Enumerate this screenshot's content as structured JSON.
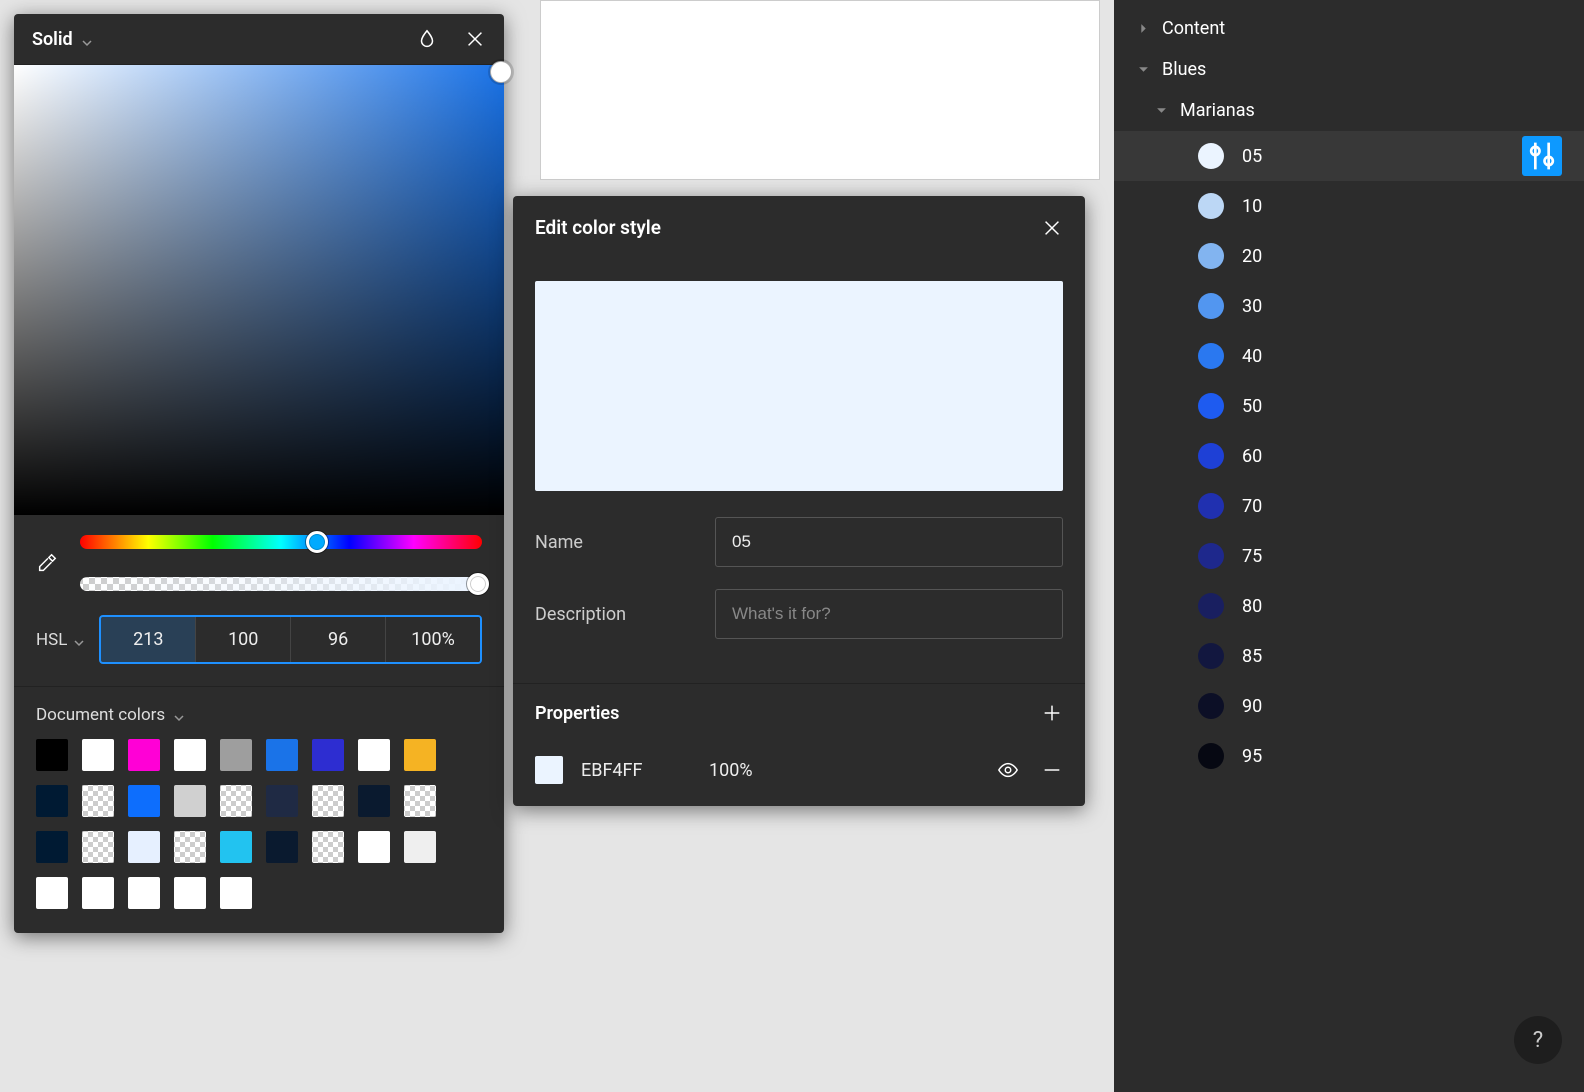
{
  "color_picker": {
    "mode_label": "Solid",
    "model_label": "HSL",
    "h": "213",
    "s": "100",
    "l": "96",
    "a": "100%",
    "doc_colors_label": "Document colors",
    "doc_swatches": [
      {
        "c": "#000000"
      },
      {
        "c": "#ffffff"
      },
      {
        "c": "#ff00d6"
      },
      {
        "c": "#ffffff"
      },
      {
        "c": "#9e9e9e"
      },
      {
        "c": "#1a73e8"
      },
      {
        "c": "#2d2dd1"
      },
      {
        "c": "#ffffff"
      },
      {
        "c": "#f5b323"
      },
      {
        "c": "#001a33"
      },
      {
        "checker": true
      },
      {
        "c": "#0d6efd"
      },
      {
        "c": "#d0d0d0"
      },
      {
        "checker": true
      },
      {
        "c": "#1f2a44"
      },
      {
        "checker": true
      },
      {
        "c": "#0a1a2f"
      },
      {
        "checker": true
      },
      {
        "c": "#001a33"
      },
      {
        "checker": true
      },
      {
        "c": "#e6f0ff"
      },
      {
        "checker": true
      },
      {
        "c": "#22c3f0"
      },
      {
        "c": "#0a1a2f"
      },
      {
        "checker": true
      },
      {
        "c": "#ffffff"
      },
      {
        "c": "#efefef"
      },
      {
        "c": "#ffffff"
      },
      {
        "c": "#ffffff"
      },
      {
        "c": "#ffffff"
      },
      {
        "c": "#ffffff"
      },
      {
        "c": "#ffffff"
      }
    ]
  },
  "edit_panel": {
    "title": "Edit color style",
    "preview_color": "#EBF4FF",
    "name_label": "Name",
    "name_value": "05",
    "desc_label": "Description",
    "desc_placeholder": "What's it for?",
    "properties_label": "Properties",
    "prop_hex": "EBF4FF",
    "prop_opacity": "100%"
  },
  "sidebar": {
    "groups": [
      {
        "label": "Content",
        "expanded": false
      },
      {
        "label": "Blues",
        "expanded": true,
        "children": [
          {
            "label": "Marianas",
            "expanded": true,
            "items": [
              {
                "label": "05",
                "color": "#ebf4ff",
                "active": true
              },
              {
                "label": "10",
                "color": "#bcd7f5"
              },
              {
                "label": "20",
                "color": "#82b4f0"
              },
              {
                "label": "30",
                "color": "#5296f0"
              },
              {
                "label": "40",
                "color": "#2a78f0"
              },
              {
                "label": "50",
                "color": "#1e5bf0"
              },
              {
                "label": "60",
                "color": "#1e40d6"
              },
              {
                "label": "70",
                "color": "#2030b0"
              },
              {
                "label": "75",
                "color": "#1e288c"
              },
              {
                "label": "80",
                "color": "#191f60"
              },
              {
                "label": "85",
                "color": "#12173f"
              },
              {
                "label": "90",
                "color": "#0c0f26"
              },
              {
                "label": "95",
                "color": "#060812"
              }
            ]
          }
        ]
      }
    ],
    "help": "?"
  }
}
